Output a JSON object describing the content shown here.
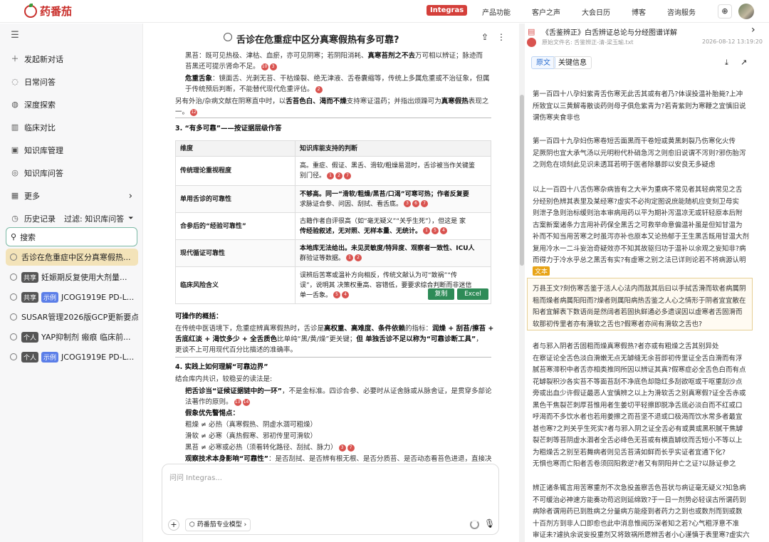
{
  "app": {
    "logo": "药番茄",
    "brand": "Integras",
    "nav": [
      "产品功能",
      "客户之声",
      "大会日历",
      "博客",
      "咨询服务"
    ]
  },
  "sidebar": {
    "items": [
      {
        "label": "发起新对话",
        "icon": "plus-icon"
      },
      {
        "label": "日常问答",
        "icon": "chat-icon"
      },
      {
        "label": "深度探索",
        "icon": "explore-icon"
      },
      {
        "label": "临床对比",
        "icon": "compare-icon"
      },
      {
        "label": "知识库管理",
        "icon": "kb-icon"
      },
      {
        "label": "知识库问答",
        "icon": "kb-qa-icon"
      },
      {
        "label": "更多",
        "icon": "grid-icon"
      }
    ],
    "history_label": "历史记录",
    "filter_label": "过滤: 知识库问答",
    "search": "搜索",
    "history": [
      {
        "title": "舌诊在危重症中区分真寒假热...",
        "tags": []
      },
      {
        "title": "妊娠期反复使用大剂量...",
        "tags": [
          "共享"
        ]
      },
      {
        "title": "JCOG1919E PD-L...",
        "tags": [
          "共享",
          "示例"
        ]
      },
      {
        "title": "SUSAR管理2026版GCP更新要点",
        "tags": []
      },
      {
        "title": "YAP抑制剂 瘢痕 临床前...",
        "tags": [
          "个人"
        ]
      },
      {
        "title": "JCOG1919E PD-L...",
        "tags": [
          "个人",
          "示例"
        ]
      }
    ]
  },
  "main": {
    "title": "舌诊在危重症中区分真寒假热有多可靠?",
    "l1a": "黑苔：既可见热极、津枯、血瘀，亦可见阴寒；若阴阳消耗、",
    "l1b": "真寒苔剂之不去",
    "l1c": "万可相以辨证；脉迹而",
    "l2": "苔黑还可提示肾命不足。",
    "l3a": "危重舌象",
    "l3b": "：镜面舌、光剥无苔、干枯燥裂、绝无津液、舌卷囊缩等，传统上多属危重或不治征象，但属",
    "l4": "于传统预后判断，不能替代现代危重评估。",
    "l5a": "另有外治/杂病文献在阴寒直中时，以",
    "l5b": "舌苔色白、渴而不燥",
    "l5c": "支持寒证温药；并指出烦躁可为",
    "l5d": "真寒假热",
    "l5e": "表现之",
    "l6": "一。",
    "h3": "3. “有多可靠”——按证据层级作答",
    "table": {
      "headers": [
        "维度",
        "知识库能支持的判断"
      ],
      "rows": [
        {
          "k": "传统理论重视程度",
          "v": [
            "高。重症、假证、黑舌、滑软/粗燥易混时，舌诊被当作关键鉴",
            "别门径。"
          ]
        },
        {
          "k": "单用舌诊的可靠性",
          "v": [
            "不够高。同一“滑软/粗燥/黑苔/口渴”可寒可热；作者反复要",
            "求脉证合参、问因、刮拭、看舌底。"
          ]
        },
        {
          "k": "合参后的“经验可靠性”",
          "v": [
            "古籍作者自评很高（如“毫无疑义”“关乎生死”），但这是 家",
            "传经验叙述，无对照、无样本量、无统计。"
          ]
        },
        {
          "k": "现代循证可靠性",
          "v": [
            "本地库无法给出。未见灵敏度/特异度、观察者一致性、ICU人",
            "群验证等数据。"
          ]
        },
        {
          "k": "临床风险含义",
          "v": [
            "误辨后苦寒或温补方向相反，传统文献认为可“致祸”“传",
            "误”，说明其 决策权重高、容错低，要要求综合判断而非迷信",
            "单一舌象。"
          ]
        }
      ]
    },
    "copy": "复制",
    "excel": "Excel",
    "p1": "可操作的概括：",
    "p2a": "在传统中医语境下，危重症辨真寒假热时，舌诊是",
    "p2b": "高权重、高难度、条件依赖",
    "p2c": "的指标：",
    "p2d": "润燥 + 刮苔/擦苔 +",
    "p3a": "舌底红淡 + 渴饮多少 + 全舌质色",
    "p3b": "比单纯“黑/黄/燥”更关键；",
    "p3c": "但 单独舌诊不足以称为“可靠诊断工具”",
    "p3d": "，",
    "p4": "更谈不上可用现代百分比描述的准确率。",
    "h4": "4. 实践上如何理解“可靠边界”",
    "p5": "结合库内共识，较稳妥的读法是:",
    "p6a": "把舌诊当“证候证据链中的一环”",
    "p6b": "，不是金标准。四诊合参、必要时从证舍脉或从脉舍证，是贯穿多部论",
    "p7": "法著作的原则。",
    "p8": "假象优先警惕点：",
    "p9": "粗燥 ≠ 必热（真寒假热、阴虚水涸可粗燥）",
    "p10": "滑软 ≠ 必寒（真热假寒、邪初传里可滑软）",
    "p11": "黑苔 ≠ 必寒或必热（须看转化路径、刮拭、脉力）",
    "p12a": "观察技术本身影响“可靠性”",
    "p12b": "：是否刮拭、是否辨有根无根、是否分质苔、是否动态看苔色进退，直接决",
    "input_placeholder": "问问 Integras...",
    "model": "药番茄专业模型"
  },
  "right": {
    "title": "《舌鉴辨正》白舌辨证总论与分经图谱详解",
    "source": "原始文件名: 舌鉴辨正-清-梁玉瑜.txt",
    "date": "2026-08-12 13:19:20",
    "tabs": [
      "原文",
      "关键信息"
    ],
    "label": "文本",
    "paras": [
      [
        "第一百四十八孕妇紫青舌伤寒无此舌其或有者乃?体误投温补胎毙?上冲",
        "所致宜以三黄解毒散谈药则母子俱危紫青为?若青紫则为寒鞭之宜慎旧说",
        "谓伤寒夹食非也"
      ],
      [
        "第一百四十九孕妇伤寒卷短舌面黑而干卷短或黄黑刺裂乃伤寒化火传",
        "足厥阴也宜大承气汤以元明粉代朴硝急泻之则愈旧说谓不泻则?邪伤胎泻",
        "之则危在顷刻此见识未透耳若明于医者除暴即以安良无多疑虑"
      ],
      [
        "以上一百四十八舌伤寒杂病皆有之大半为重病不常见者其轻病常见之舌",
        "分经别色辨其表里及某经寒?虚实不必拘定图说庶能随机应变刻卫母实",
        "则泄子急则治标缓则治本审病用药以平为期补泻温凉无或轩轻原本后附",
        "古案新案诸条力言用补药保全黑舌之可救举命意偏温补虽是但知甘温为",
        "补而不知当用苦寒之时虽泻亦补也原本又论热郁于王生黑舌既用甘温大剂",
        "复用冷水一二斗妄治奇疑效亦不知其故驱归功于温补以余观之妄知非?病",
        "而得力于冷水乎总之黑舌有实?有虚寒之别之法已详则论若不将病源认明",
        "在先而以探试幸中之药昧表影于后断定某药可治某舌鲜不传误矣"
      ],
      [
        "万县王文?刻伤寒舌鉴于活人心法内而敌其后曰以手拭舌滑而软者病属阴",
        "租而燥者病属阳阳而?燥者则属阳病热舌鉴之人心之情形于阴者宜宜散在",
        "阳者宜解表下数语尚是然阔者若固执鲜通必多遗误因以虚寒者舌固滑而",
        "软那初传里者亦有滑软之舌也?假寒者亦间有滑软之舌也?"
      ],
      [
        "者与邪入阴者舌固粗而燥真寒假热?者亦或有粗燥之舌其别异处",
        "在察证论全舌色淡白滑嫩无点无罅缝无余苔即初传里证全舌白滑而有浮",
        "腻苔寒滞积中者舌亦相类推同所因以辨证其真?假寒症必全舌色白而有点",
        "花罅裂积沙各实苔不等面苔刮不净底色却隐红多刮欲呕或干呕重刮沙点",
        "旁或出血少许假证最恶人宜慎辨之以上为滑软舌之别真寒假?证全舌赤或",
        "黑色干焦裂芒刺厚苔惟用者生姜切平轻擦即脱净舌底必淡白而不红或口",
        "呼渴而不多饮水者也若用姜擦之而苔坚不退或口极渴而饮水常多者最宜",
        "甚也寒?之判关乎生死实?者与邪入阴之证全舌必有或黄或黑积腻干焦罅",
        "裂芒刺等苔阴虚水涸者全舌必绛色无苔或有横直罅纹而舌短小不等以上",
        "为粗燥舌之别至若舞病者则见舌苔清如鲜而长乎实证者宜通下化?",
        "无惧也寒而亡阳者舌卷须回阳救逆?者又有阴阳并亡之证?以脉证参之",
        "甚也"
      ],
      [
        "辨正诸条辄言用苦寒重剂不次急投盖察舌色苔状与病证毫无疑义?知急病",
        "不可缓治必神速方能奏功苟迟则延绵致?于一日一剂势必轻误古所谓药到",
        "病除者谓用药已到胜病之分量病方能痊到者药力之到也或数剂而到或数",
        "十百剂方到非人口即愈也此中消息惟阅历深者知之若?心气粗浮意不准",
        "审证未?遽执余说妄投重剂又将致祸所愿辨舌者小心谨慎于表里寒?虚实六"
      ]
    ]
  }
}
